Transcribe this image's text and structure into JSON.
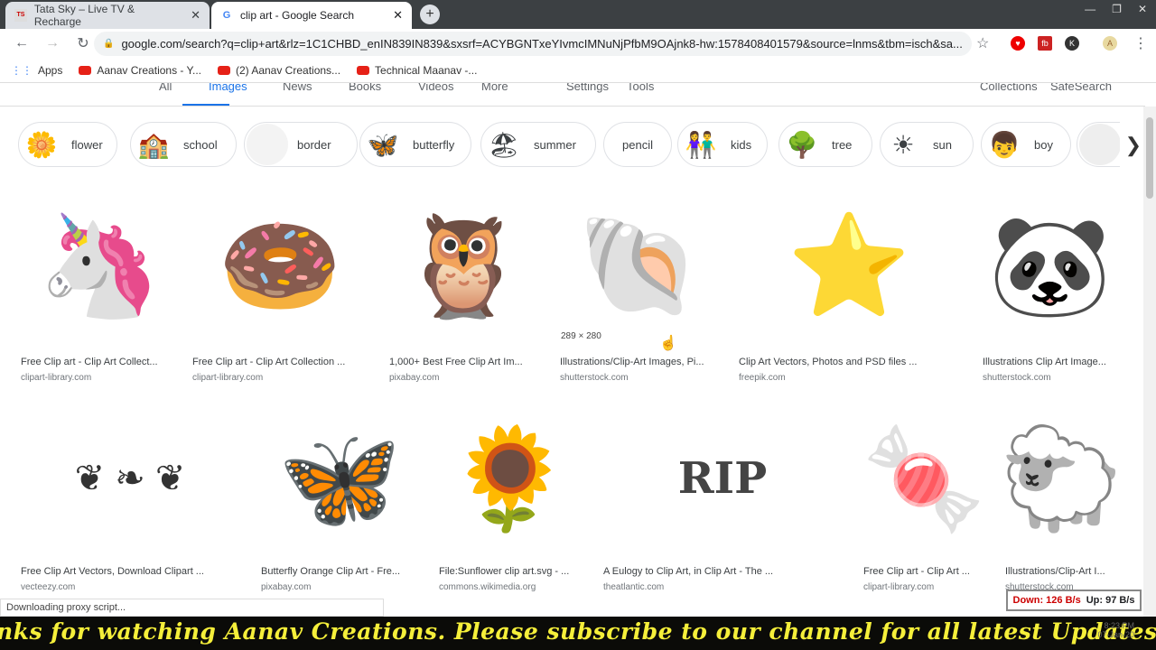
{
  "browser": {
    "tabs": [
      {
        "title": "Tata Sky – Live TV & Recharge",
        "active": false
      },
      {
        "title": "clip art - Google Search",
        "active": true
      }
    ],
    "url": "google.com/search?q=clip+art&rlz=1C1CHBD_enIN839IN839&sxsrf=ACYBGNTxeYIvmcIMNuNjPfbM9OAjnk8-hw:1578408401579&source=lnms&tbm=isch&sa...",
    "bookmarks": [
      "Apps",
      "Aanav Creations - Y...",
      "(2) Aanav Creations...",
      "Technical Maanav -..."
    ]
  },
  "google_nav": {
    "items": [
      "All",
      "Images",
      "News",
      "Books",
      "Videos",
      "More",
      "Settings",
      "Tools",
      "Collections",
      "SafeSearch"
    ]
  },
  "chips": [
    {
      "label": "flower",
      "icon": "🌼"
    },
    {
      "label": "school",
      "icon": "🏫"
    },
    {
      "label": "border",
      "icon": ""
    },
    {
      "label": "butterfly",
      "icon": "🦋"
    },
    {
      "label": "summer",
      "icon": "🏖"
    },
    {
      "label": "pencil",
      "icon": ""
    },
    {
      "label": "kids",
      "icon": "👫"
    },
    {
      "label": "tree",
      "icon": "🌳"
    },
    {
      "label": "sun",
      "icon": "☀"
    },
    {
      "label": "boy",
      "icon": "👦"
    }
  ],
  "results": [
    {
      "title": "Free Clip art - Clip Art Collect...",
      "source": "clipart-library.com",
      "glyph": "🦄"
    },
    {
      "title": "Free Clip art - Clip Art Collection ...",
      "source": "clipart-library.com",
      "glyph": "🍩"
    },
    {
      "title": "1,000+ Best Free Clip Art Im...",
      "source": "pixabay.com",
      "glyph": "🦉"
    },
    {
      "title": "Illustrations/Clip-Art Images, Pi...",
      "source": "shutterstock.com",
      "glyph": "🐚"
    },
    {
      "title": "Clip Art Vectors, Photos and PSD files ...",
      "source": "freepik.com",
      "glyph": "⭐"
    },
    {
      "title": "Illustrations Clip Art Image...",
      "source": "shutterstock.com",
      "glyph": "🐼"
    },
    {
      "title": "Free Clip Art Vectors, Download Clipart ...",
      "source": "vecteezy.com",
      "glyph": "❦ ❧ ❦"
    },
    {
      "title": "Butterfly Orange Clip Art - Fre...",
      "source": "pixabay.com",
      "glyph": "🦋"
    },
    {
      "title": "File:Sunflower clip art.svg - ...",
      "source": "commons.wikimedia.org",
      "glyph": "🌻"
    },
    {
      "title": "A Eulogy to Clip Art, in Clip Art - The ...",
      "source": "theatlantic.com",
      "glyph": "RIP"
    },
    {
      "title": "Free Clip art - Clip Art ...",
      "source": "clipart-library.com",
      "glyph": "🍬"
    },
    {
      "title": "Illustrations/Clip-Art I...",
      "source": "shutterstock.com",
      "glyph": "🐑"
    }
  ],
  "hover_dimensions": "289 × 280",
  "status_text": "Downloading proxy script...",
  "net_meter": {
    "down": "Down: 126 B/s",
    "up": "Up: 97 B/s"
  },
  "ticker": "nks for watching Aanav Creations. Please subscribe to our channel for all latest Updates.",
  "clock": {
    "time": "8:23 PM",
    "date": "07-Jan-20"
  }
}
